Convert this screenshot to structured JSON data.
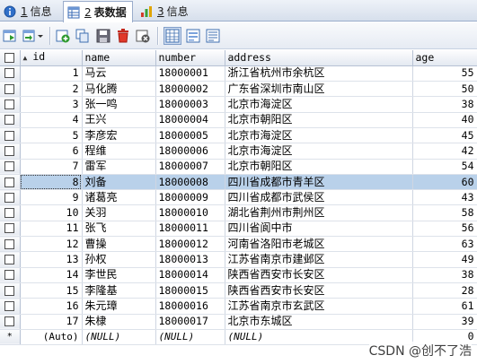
{
  "tabs": [
    {
      "number": "1",
      "label": "信息",
      "active": false,
      "icon": "info-icon"
    },
    {
      "number": "2",
      "label": "表数据",
      "active": true,
      "icon": "table-data-icon"
    },
    {
      "number": "3",
      "label": "信息",
      "active": false,
      "icon": "info-chart-icon"
    }
  ],
  "toolbar": {
    "icons": [
      "export-grid-icon",
      "import-grid-icon",
      "add-row-icon",
      "duplicate-row-icon",
      "save-icon",
      "delete-icon",
      "cancel-icon",
      "grid-view-icon",
      "form-view-icon",
      "text-view-icon"
    ]
  },
  "grid": {
    "columns": [
      "id",
      "name",
      "number",
      "address",
      "age"
    ],
    "rows": [
      {
        "id": "1",
        "name": "马云",
        "number": "18000001",
        "address": "浙江省杭州市余杭区",
        "age": "55"
      },
      {
        "id": "2",
        "name": "马化腾",
        "number": "18000002",
        "address": "广东省深圳市南山区",
        "age": "50"
      },
      {
        "id": "3",
        "name": "张一鸣",
        "number": "18000003",
        "address": "北京市海淀区",
        "age": "38"
      },
      {
        "id": "4",
        "name": "王兴",
        "number": "18000004",
        "address": "北京市朝阳区",
        "age": "40"
      },
      {
        "id": "5",
        "name": "李彦宏",
        "number": "18000005",
        "address": "北京市海淀区",
        "age": "45"
      },
      {
        "id": "6",
        "name": "程维",
        "number": "18000006",
        "address": "北京市海淀区",
        "age": "42"
      },
      {
        "id": "7",
        "name": "雷军",
        "number": "18000007",
        "address": "北京市朝阳区",
        "age": "54"
      },
      {
        "id": "8",
        "name": "刘备",
        "number": "18000008",
        "address": "四川省成都市青羊区",
        "age": "60"
      },
      {
        "id": "9",
        "name": "诸葛亮",
        "number": "18000009",
        "address": "四川省成都市武侯区",
        "age": "43"
      },
      {
        "id": "10",
        "name": "关羽",
        "number": "18000010",
        "address": "湖北省荆州市荆州区",
        "age": "58"
      },
      {
        "id": "11",
        "name": "张飞",
        "number": "18000011",
        "address": "四川省阆中市",
        "age": "56"
      },
      {
        "id": "12",
        "name": "曹操",
        "number": "18000012",
        "address": "河南省洛阳市老城区",
        "age": "63"
      },
      {
        "id": "13",
        "name": "孙权",
        "number": "18000013",
        "address": "江苏省南京市建邺区",
        "age": "49"
      },
      {
        "id": "14",
        "name": "李世民",
        "number": "18000014",
        "address": "陕西省西安市长安区",
        "age": "38"
      },
      {
        "id": "15",
        "name": "李隆基",
        "number": "18000015",
        "address": "陕西省西安市长安区",
        "age": "28"
      },
      {
        "id": "16",
        "name": "朱元璋",
        "number": "18000016",
        "address": "江苏省南京市玄武区",
        "age": "61"
      },
      {
        "id": "17",
        "name": "朱棣",
        "number": "18000017",
        "address": "北京市东城区",
        "age": "39"
      }
    ],
    "selected_row": "8",
    "new_row": {
      "marker": "*",
      "id": "(Auto)",
      "name": "(NULL)",
      "number": "(NULL)",
      "address": "(NULL)",
      "age": "0"
    }
  },
  "watermark": "CSDN @创不了浩"
}
